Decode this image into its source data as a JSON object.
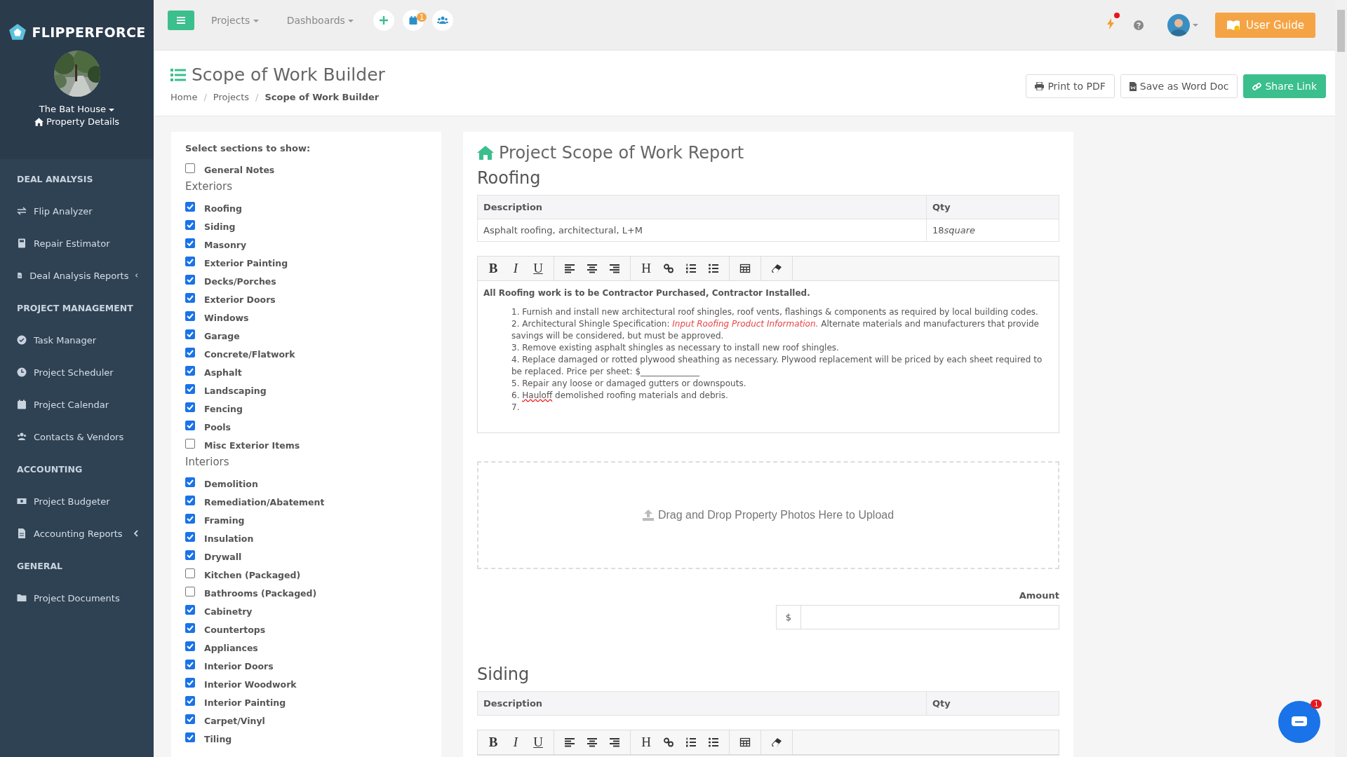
{
  "sidebar": {
    "logo": "FLIPPERFORCE",
    "property": "The Bat House",
    "property_link": "Property Details",
    "sections": [
      {
        "title": "DEAL ANALYSIS",
        "items": [
          {
            "label": "Flip Analyzer",
            "kind": "swap",
            "expandable": false
          },
          {
            "label": "Repair Estimator",
            "kind": "calculator",
            "expandable": false
          },
          {
            "label": "Deal Analysis Reports",
            "kind": "file",
            "expandable": true
          }
        ]
      },
      {
        "title": "PROJECT MANAGEMENT",
        "items": [
          {
            "label": "Task Manager",
            "kind": "check",
            "expandable": false
          },
          {
            "label": "Project Scheduler",
            "kind": "clock",
            "expandable": false
          },
          {
            "label": "Project Calendar",
            "kind": "calendar",
            "expandable": false
          },
          {
            "label": "Contacts & Vendors",
            "kind": "users",
            "expandable": false
          }
        ]
      },
      {
        "title": "ACCOUNTING",
        "items": [
          {
            "label": "Project Budgeter",
            "kind": "money",
            "expandable": false
          },
          {
            "label": "Accounting Reports",
            "kind": "file",
            "expandable": true
          }
        ]
      },
      {
        "title": "GENERAL",
        "items": [
          {
            "label": "Project Documents",
            "kind": "folder",
            "expandable": false
          }
        ]
      }
    ]
  },
  "topbar": {
    "menus": [
      "Projects",
      "Dashboards"
    ],
    "calendar_badge": "1",
    "alert": true,
    "user_guide": "User Guide"
  },
  "header": {
    "title": "Scope of Work Builder",
    "separator": "/",
    "breadcrumb": [
      {
        "label": "Home",
        "current": false
      },
      {
        "label": "Projects",
        "current": false
      },
      {
        "label": "Scope of Work Builder",
        "current": true
      }
    ],
    "buttons": [
      {
        "label": "Print to PDF",
        "kind": "print"
      },
      {
        "label": "Save as Word Doc",
        "kind": "word"
      },
      {
        "label": "Share Link",
        "kind": "share"
      }
    ]
  },
  "sections_panel": {
    "title": "Select sections to show:",
    "items": [
      {
        "kind": "checkbox",
        "label": "General Notes",
        "checked": false
      },
      {
        "kind": "heading",
        "label": "Exteriors"
      },
      {
        "kind": "checkbox",
        "label": "Roofing",
        "checked": true
      },
      {
        "kind": "checkbox",
        "label": "Siding",
        "checked": true
      },
      {
        "kind": "checkbox",
        "label": "Masonry",
        "checked": true
      },
      {
        "kind": "checkbox",
        "label": "Exterior Painting",
        "checked": true
      },
      {
        "kind": "checkbox",
        "label": "Decks/Porches",
        "checked": true
      },
      {
        "kind": "checkbox",
        "label": "Exterior Doors",
        "checked": true
      },
      {
        "kind": "checkbox",
        "label": "Windows",
        "checked": true
      },
      {
        "kind": "checkbox",
        "label": "Garage",
        "checked": true
      },
      {
        "kind": "checkbox",
        "label": "Concrete/Flatwork",
        "checked": true
      },
      {
        "kind": "checkbox",
        "label": "Asphalt",
        "checked": true
      },
      {
        "kind": "checkbox",
        "label": "Landscaping",
        "checked": true
      },
      {
        "kind": "checkbox",
        "label": "Fencing",
        "checked": true
      },
      {
        "kind": "checkbox",
        "label": "Pools",
        "checked": true
      },
      {
        "kind": "checkbox",
        "label": "Misc Exterior Items",
        "checked": false
      },
      {
        "kind": "heading",
        "label": "Interiors"
      },
      {
        "kind": "checkbox",
        "label": "Demolition",
        "checked": true
      },
      {
        "kind": "checkbox",
        "label": "Remediation/Abatement",
        "checked": true
      },
      {
        "kind": "checkbox",
        "label": "Framing",
        "checked": true
      },
      {
        "kind": "checkbox",
        "label": "Insulation",
        "checked": true
      },
      {
        "kind": "checkbox",
        "label": "Drywall",
        "checked": true
      },
      {
        "kind": "checkbox",
        "label": "Kitchen (Packaged)",
        "checked": false
      },
      {
        "kind": "checkbox",
        "label": "Bathrooms (Packaged)",
        "checked": false
      },
      {
        "kind": "checkbox",
        "label": "Cabinetry",
        "checked": true
      },
      {
        "kind": "checkbox",
        "label": "Countertops",
        "checked": true
      },
      {
        "kind": "checkbox",
        "label": "Appliances",
        "checked": true
      },
      {
        "kind": "checkbox",
        "label": "Interior Doors",
        "checked": true
      },
      {
        "kind": "checkbox",
        "label": "Interior Woodwork",
        "checked": true
      },
      {
        "kind": "checkbox",
        "label": "Interior Painting",
        "checked": true
      },
      {
        "kind": "checkbox",
        "label": "Carpet/Vinyl",
        "checked": true
      },
      {
        "kind": "checkbox",
        "label": "Tiling",
        "checked": true
      }
    ]
  },
  "report": {
    "title": "Project Scope of Work Report",
    "sections": [
      {
        "title": "Roofing",
        "columns": [
          "Description",
          "Qty"
        ],
        "rows": [
          {
            "description": "Asphalt roofing, architectural, L+M",
            "qty": "18",
            "unit": "square"
          }
        ],
        "toolbar": [
          {
            "kind": "bold",
            "label": "B"
          },
          {
            "kind": "italic",
            "label": "I"
          },
          {
            "kind": "underline",
            "label": "U"
          },
          {
            "kind": "sep"
          },
          {
            "kind": "align-left"
          },
          {
            "kind": "align-center"
          },
          {
            "kind": "align-right"
          },
          {
            "kind": "sep"
          },
          {
            "kind": "heading",
            "label": "H"
          },
          {
            "kind": "link"
          },
          {
            "kind": "ordered-list"
          },
          {
            "kind": "bullet-list"
          },
          {
            "kind": "sep"
          },
          {
            "kind": "table"
          },
          {
            "kind": "sep"
          },
          {
            "kind": "eraser"
          }
        ],
        "intro": "All Roofing work is to be Contractor Purchased, Contractor Installed.",
        "items": [
          [
            {
              "kind": "plain",
              "text": "1. Furnish and install new architectural roof shingles, roof vents, flashings & components as required by local building codes."
            }
          ],
          [
            {
              "kind": "plain",
              "text": "2. Architectural Shingle Specification: "
            },
            {
              "kind": "placeholder",
              "text": "Input Roofing Product Information."
            },
            {
              "kind": "plain",
              "text": " Alternate materials and manufacturers that provide savings will be considered, but must be approved."
            }
          ],
          [
            {
              "kind": "plain",
              "text": "3. Remove existing asphalt shingles as necessary to install new roof shingles."
            }
          ],
          [
            {
              "kind": "plain",
              "text": "4. Replace damaged or rotted plywood sheathing as necessary. Plywood replacement will be priced by each sheet required to be replaced. Price per sheet: $______________"
            }
          ],
          [
            {
              "kind": "plain",
              "text": "5. Repair any loose or damaged gutters or downspouts."
            }
          ],
          [
            {
              "kind": "plain",
              "text": "6. "
            },
            {
              "kind": "misspelled",
              "text": "Hauloff"
            },
            {
              "kind": "plain",
              "text": " demolished roofing materials and debris."
            }
          ],
          [
            {
              "kind": "plain",
              "text": "7."
            }
          ]
        ],
        "upload": "Drag and Drop Property Photos Here to Upload",
        "amount_label": "Amount",
        "currency": "$"
      },
      {
        "title": "Siding",
        "columns": [
          "Description",
          "Qty"
        ],
        "toolbar": [
          {
            "kind": "bold",
            "label": "B"
          },
          {
            "kind": "italic",
            "label": "I"
          },
          {
            "kind": "underline",
            "label": "U"
          },
          {
            "kind": "sep"
          },
          {
            "kind": "align-left"
          },
          {
            "kind": "align-center"
          },
          {
            "kind": "align-right"
          },
          {
            "kind": "sep"
          },
          {
            "kind": "heading",
            "label": "H"
          },
          {
            "kind": "link"
          },
          {
            "kind": "ordered-list"
          },
          {
            "kind": "bullet-list"
          },
          {
            "kind": "sep"
          },
          {
            "kind": "table"
          },
          {
            "kind": "sep"
          },
          {
            "kind": "eraser"
          }
        ]
      }
    ]
  },
  "chat": {
    "badge": "1"
  }
}
